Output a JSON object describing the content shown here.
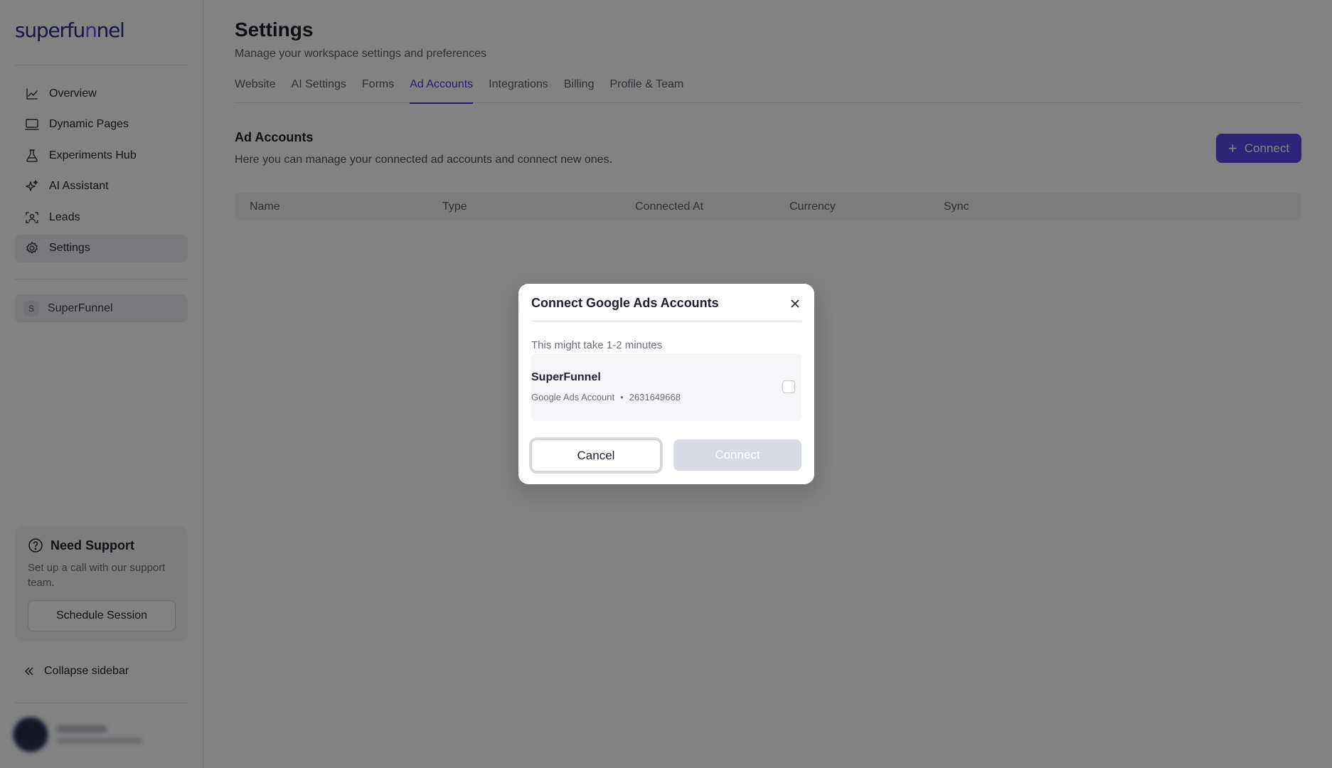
{
  "brand": {
    "logo_text_a": "superfu",
    "logo_text_b": "n",
    "logo_text_c": "nel",
    "accent_color": "#5a47e8"
  },
  "sidebar": {
    "items": [
      {
        "label": "Overview",
        "icon": "chart-line-icon"
      },
      {
        "label": "Dynamic Pages",
        "icon": "monitor-icon"
      },
      {
        "label": "Experiments Hub",
        "icon": "flask-icon"
      },
      {
        "label": "AI Assistant",
        "icon": "sparkles-icon"
      },
      {
        "label": "Leads",
        "icon": "user-scan-icon"
      },
      {
        "label": "Settings",
        "icon": "gear-icon",
        "active": true
      }
    ],
    "workspace": {
      "initial": "S",
      "name": "SuperFunnel"
    },
    "support": {
      "title": "Need Support",
      "text": "Set up a call with our support team.",
      "button": "Schedule Session"
    },
    "collapse_label": "Collapse sidebar"
  },
  "main": {
    "title": "Settings",
    "subtitle": "Manage your workspace settings and preferences",
    "tabs": [
      {
        "label": "Website"
      },
      {
        "label": "AI Settings"
      },
      {
        "label": "Forms"
      },
      {
        "label": "Ad Accounts",
        "active": true
      },
      {
        "label": "Integrations"
      },
      {
        "label": "Billing"
      },
      {
        "label": "Profile & Team"
      }
    ],
    "section": {
      "title": "Ad Accounts",
      "description": "Here you can manage your connected ad accounts and connect new ones.",
      "connect_button": "Connect"
    },
    "table": {
      "columns": [
        "Name",
        "Type",
        "Connected At",
        "Currency",
        "Sync"
      ]
    }
  },
  "modal": {
    "title": "Connect Google Ads Accounts",
    "note": "This might take 1-2 minutes",
    "account": {
      "name": "SuperFunnel",
      "type": "Google Ads Account",
      "separator": "•",
      "id": "2631649668",
      "checked": false
    },
    "cancel_label": "Cancel",
    "connect_label": "Connect"
  }
}
